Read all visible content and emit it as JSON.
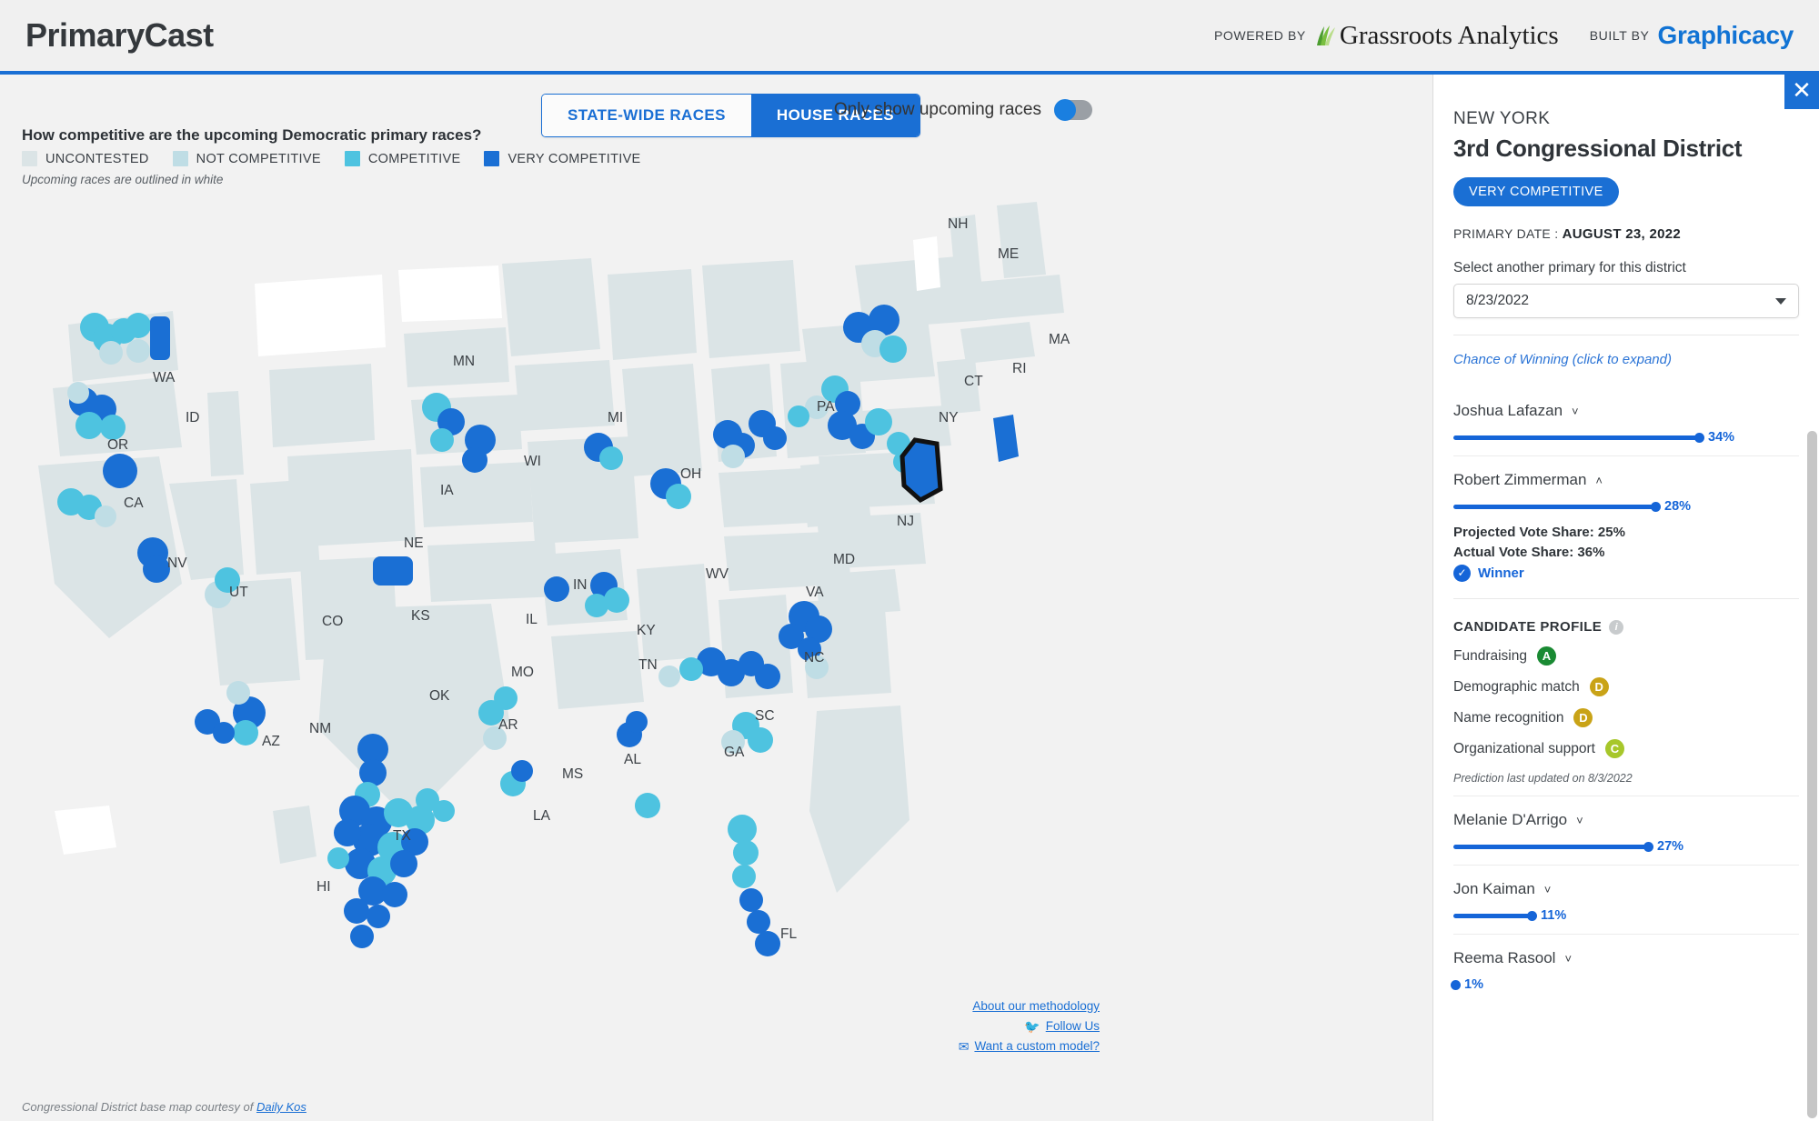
{
  "header": {
    "brand": "PrimaryCast",
    "powered_by_label": "POWERED BY",
    "powered_by_name": "Grassroots Analytics",
    "built_by_label": "BUILT BY",
    "built_by_name": "Graphicacy"
  },
  "controls": {
    "tab_statewide": "STATE-WIDE RACES",
    "tab_house": "HOUSE RACES",
    "active_tab": "HOUSE RACES",
    "toggle_label": "Only show upcoming races",
    "toggle_on": false
  },
  "legend": {
    "title": "How competitive are the upcoming Democratic primary races?",
    "note": "Upcoming races are outlined in white",
    "items": [
      {
        "label": "UNCONTESTED",
        "color": "#dbe4e6"
      },
      {
        "label": "NOT COMPETITIVE",
        "color": "#bfdde5"
      },
      {
        "label": "COMPETITIVE",
        "color": "#4ec3e0"
      },
      {
        "label": "VERY COMPETITIVE",
        "color": "#1a6fd4"
      }
    ]
  },
  "map": {
    "state_labels": [
      "NH",
      "ME",
      "MA",
      "RI",
      "CT",
      "NY",
      "NJ",
      "PA",
      "MI",
      "MN",
      "WI",
      "OH",
      "IA",
      "MD",
      "WV",
      "VA",
      "IN",
      "IL",
      "KY",
      "NC",
      "KS",
      "MO",
      "TN",
      "SC",
      "OK",
      "AR",
      "AL",
      "GA",
      "MS",
      "LA",
      "CO",
      "NM",
      "AZ",
      "TX",
      "UT",
      "NV",
      "CA",
      "OR",
      "ID",
      "WA",
      "NE",
      "FL",
      "HI"
    ],
    "basemap_credit_text": "Congressional District base map courtesy of ",
    "basemap_credit_link": "Daily Kos",
    "links": [
      {
        "label": "About our methodology",
        "icon": ""
      },
      {
        "label": "Follow Us",
        "icon": "twitter-icon"
      },
      {
        "label": "Want a custom model?",
        "icon": "envelope-icon"
      }
    ]
  },
  "panel": {
    "close_icon": "✕",
    "state": "NEW YORK",
    "district": "3rd Congressional District",
    "badge": "VERY COMPETITIVE",
    "primary_date_label": "PRIMARY DATE :",
    "primary_date_value": "AUGUST 23, 2022",
    "select_label": "Select another primary for this district",
    "select_value": "8/23/2022",
    "chance_link": "Chance of Winning (click to expand)",
    "candidates": [
      {
        "name": "Joshua Lafazan",
        "chevron": "˅",
        "percent": "34%",
        "percent_value": 34,
        "expanded": false
      },
      {
        "name": "Robert Zimmerman",
        "chevron": "˄",
        "percent": "28%",
        "percent_value": 28,
        "expanded": true,
        "projected_vote_share": "Projected Vote Share: 25%",
        "actual_vote_share": "Actual Vote Share: 36%",
        "winner_label": "Winner",
        "profile_title": "CANDIDATE PROFILE",
        "profile": [
          {
            "label": "Fundraising",
            "grade": "A",
            "color": "#1a8a33"
          },
          {
            "label": "Demographic match",
            "grade": "D",
            "color": "#c9a317"
          },
          {
            "label": "Name recognition",
            "grade": "D",
            "color": "#c9a317"
          },
          {
            "label": "Organizational support",
            "grade": "C",
            "color": "#a7c72b"
          }
        ],
        "prediction_updated": "Prediction last updated on 8/3/2022"
      },
      {
        "name": "Melanie D'Arrigo",
        "chevron": "˅",
        "percent": "27%",
        "percent_value": 27,
        "expanded": false
      },
      {
        "name": "Jon Kaiman",
        "chevron": "˅",
        "percent": "11%",
        "percent_value": 11,
        "expanded": false
      },
      {
        "name": "Reema Rasool",
        "chevron": "˅",
        "percent": "1%",
        "percent_value": 1,
        "expanded": false
      }
    ]
  },
  "colors": {
    "accent": "#1a6fd4",
    "bar": "#1565d8",
    "map_bg": "#f2f2f2"
  }
}
